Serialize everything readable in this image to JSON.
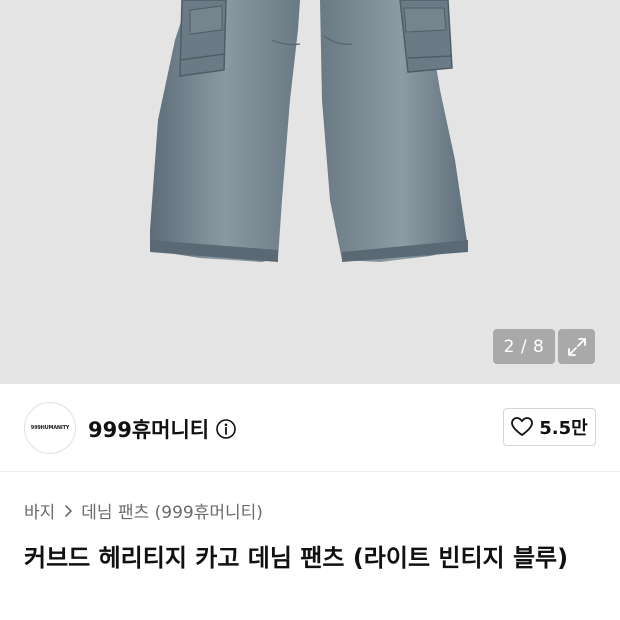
{
  "gallery": {
    "counter": "2 / 8",
    "expand_icon": "expand-icon"
  },
  "brand": {
    "logo_text": "999HUMANITY",
    "name": "999휴머니티",
    "info_icon": "info-icon"
  },
  "like": {
    "icon": "heart-icon",
    "count": "5.5만"
  },
  "breadcrumb": {
    "items": [
      "바지",
      "데님 팬츠 (999휴머니티)"
    ],
    "separator_icon": "chevron-right-icon"
  },
  "product": {
    "title": "커브드 헤리티지 카고 데님 팬츠 (라이트 빈티지 블루)"
  },
  "colors": {
    "hero_background": "#e4e4e4",
    "denim": "#6f7f8a",
    "breadcrumb_text": "#6b6b6b"
  }
}
